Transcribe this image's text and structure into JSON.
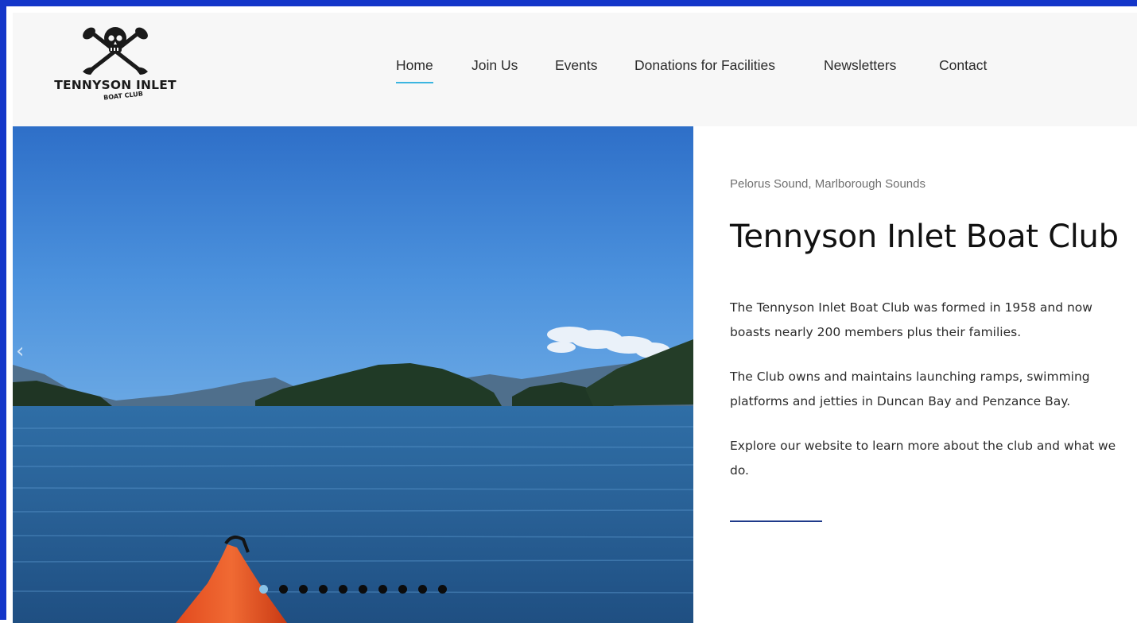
{
  "header": {
    "logo": {
      "title": "TENNYSON INLET",
      "subtitle": "BOAT CLUB",
      "icon": "skull-crossed-paddles-icon"
    },
    "nav": [
      {
        "label": "Home",
        "active": true
      },
      {
        "label": "Join Us",
        "active": false
      },
      {
        "label": "Events",
        "active": false
      },
      {
        "label": "Donations for Facilities",
        "active": false
      },
      {
        "label": "Newsletters",
        "active": false
      },
      {
        "label": "Contact",
        "active": false
      }
    ],
    "accent_color": "#3bb5e0"
  },
  "hero": {
    "image": "kayak-on-calm-inlet-photo",
    "prev_icon": "chevron-left-icon",
    "slide_count": 10,
    "active_slide": 1
  },
  "content": {
    "eyebrow": "Pelorus Sound, Marlborough Sounds",
    "title": "Tennyson Inlet Boat Club",
    "paragraphs": [
      "The Tennyson Inlet Boat Club was formed in 1958 and now boasts nearly 200 members plus their families.",
      "The Club owns and maintains launching ramps, swimming platforms and jetties in Duncan Bay and Penzance Bay.",
      "Explore our website to learn more about the club and what we do."
    ],
    "divider_color": "#1e3a8a"
  },
  "frame_color": "#1436c9"
}
